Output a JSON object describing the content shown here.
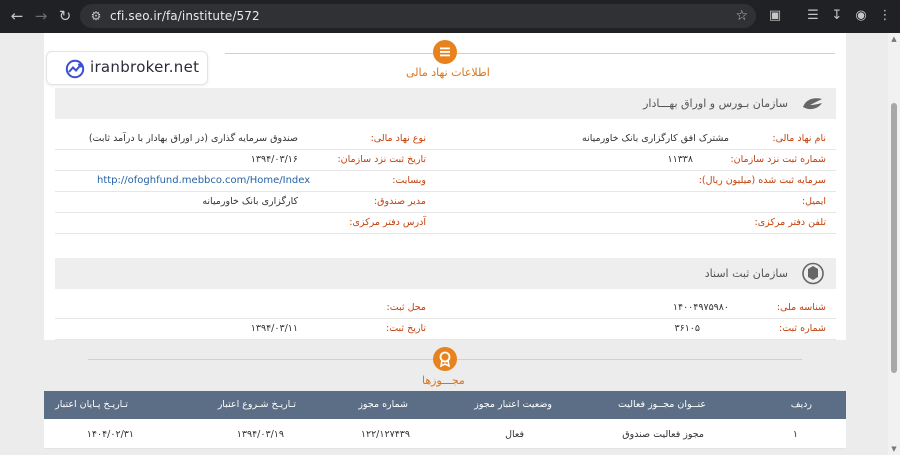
{
  "browser": {
    "url": "cfi.seo.ir/fa/institute/572"
  },
  "logo": {
    "text": "iranbroker.net"
  },
  "financial_info": {
    "title": "اطلاعات نهاد مالی"
  },
  "exchange_org": {
    "title": "سازمان بـورس و اوراق بهـــادار",
    "right": [
      {
        "label": "نام نهاد مالی:",
        "value": "مشترک افق کارگزاری بانک خاورمیانه"
      },
      {
        "label": "شماره ثبت نزد سازمان:",
        "value": "۱۱۳۳۸"
      },
      {
        "label": "سرمایه ثبت شده (میلیون ریال):",
        "value": ""
      },
      {
        "label": "ایمیل:",
        "value": ""
      },
      {
        "label": "تلفن دفتر مرکزی:",
        "value": ""
      }
    ],
    "left": [
      {
        "label": "نوع نهاد مالی:",
        "value": "صندوق سرمایه گذاری (در اوراق بهادار با درآمد ثابت)"
      },
      {
        "label": "تاریخ ثبت نزد سازمان:",
        "value": "۱۳۹۴/۰۳/۱۶"
      },
      {
        "label": "وبسایت:",
        "value": "http://ofoghfund.mebbco.com/Home/Index"
      },
      {
        "label": "مدیر صندوق:",
        "value": "کارگزاری بانک خاورمیانه"
      },
      {
        "label": "آدرس دفتر مرکزی:",
        "value": ""
      }
    ]
  },
  "registration_org": {
    "title": "سازمان ثبت اسناد",
    "right": [
      {
        "label": "شناسه ملی:",
        "value": "۱۴۰۰۴۹۷۵۹۸۰"
      },
      {
        "label": "شماره ثبت:",
        "value": "۳۶۱۰۵"
      }
    ],
    "left": [
      {
        "label": "محل ثبت:",
        "value": ""
      },
      {
        "label": "تاریخ ثبت:",
        "value": "۱۳۹۴/۰۳/۱۱"
      }
    ]
  },
  "licenses": {
    "title": "مجـــوزها",
    "headers": {
      "row": "ردیف",
      "title": "عنــوان مجــوز فعالیت",
      "status": "وضعیت اعتبار مجوز",
      "number": "شماره مجوز",
      "start": "تـاریـخ شـروع اعتبار",
      "end": "تـاریـخ پـایان اعتبار"
    },
    "rows": [
      {
        "row": "۱",
        "title": "مجوز فعالیت صندوق",
        "status": "فعال",
        "number": "۱۲۲/۱۲۷۴۳۹",
        "start": "۱۳۹۴/۰۳/۱۹",
        "end": "۱۴۰۴/۰۲/۳۱"
      }
    ]
  },
  "colors": {
    "accent": "#e8821e",
    "label": "#c2410c",
    "table_header": "#5b6e86"
  }
}
